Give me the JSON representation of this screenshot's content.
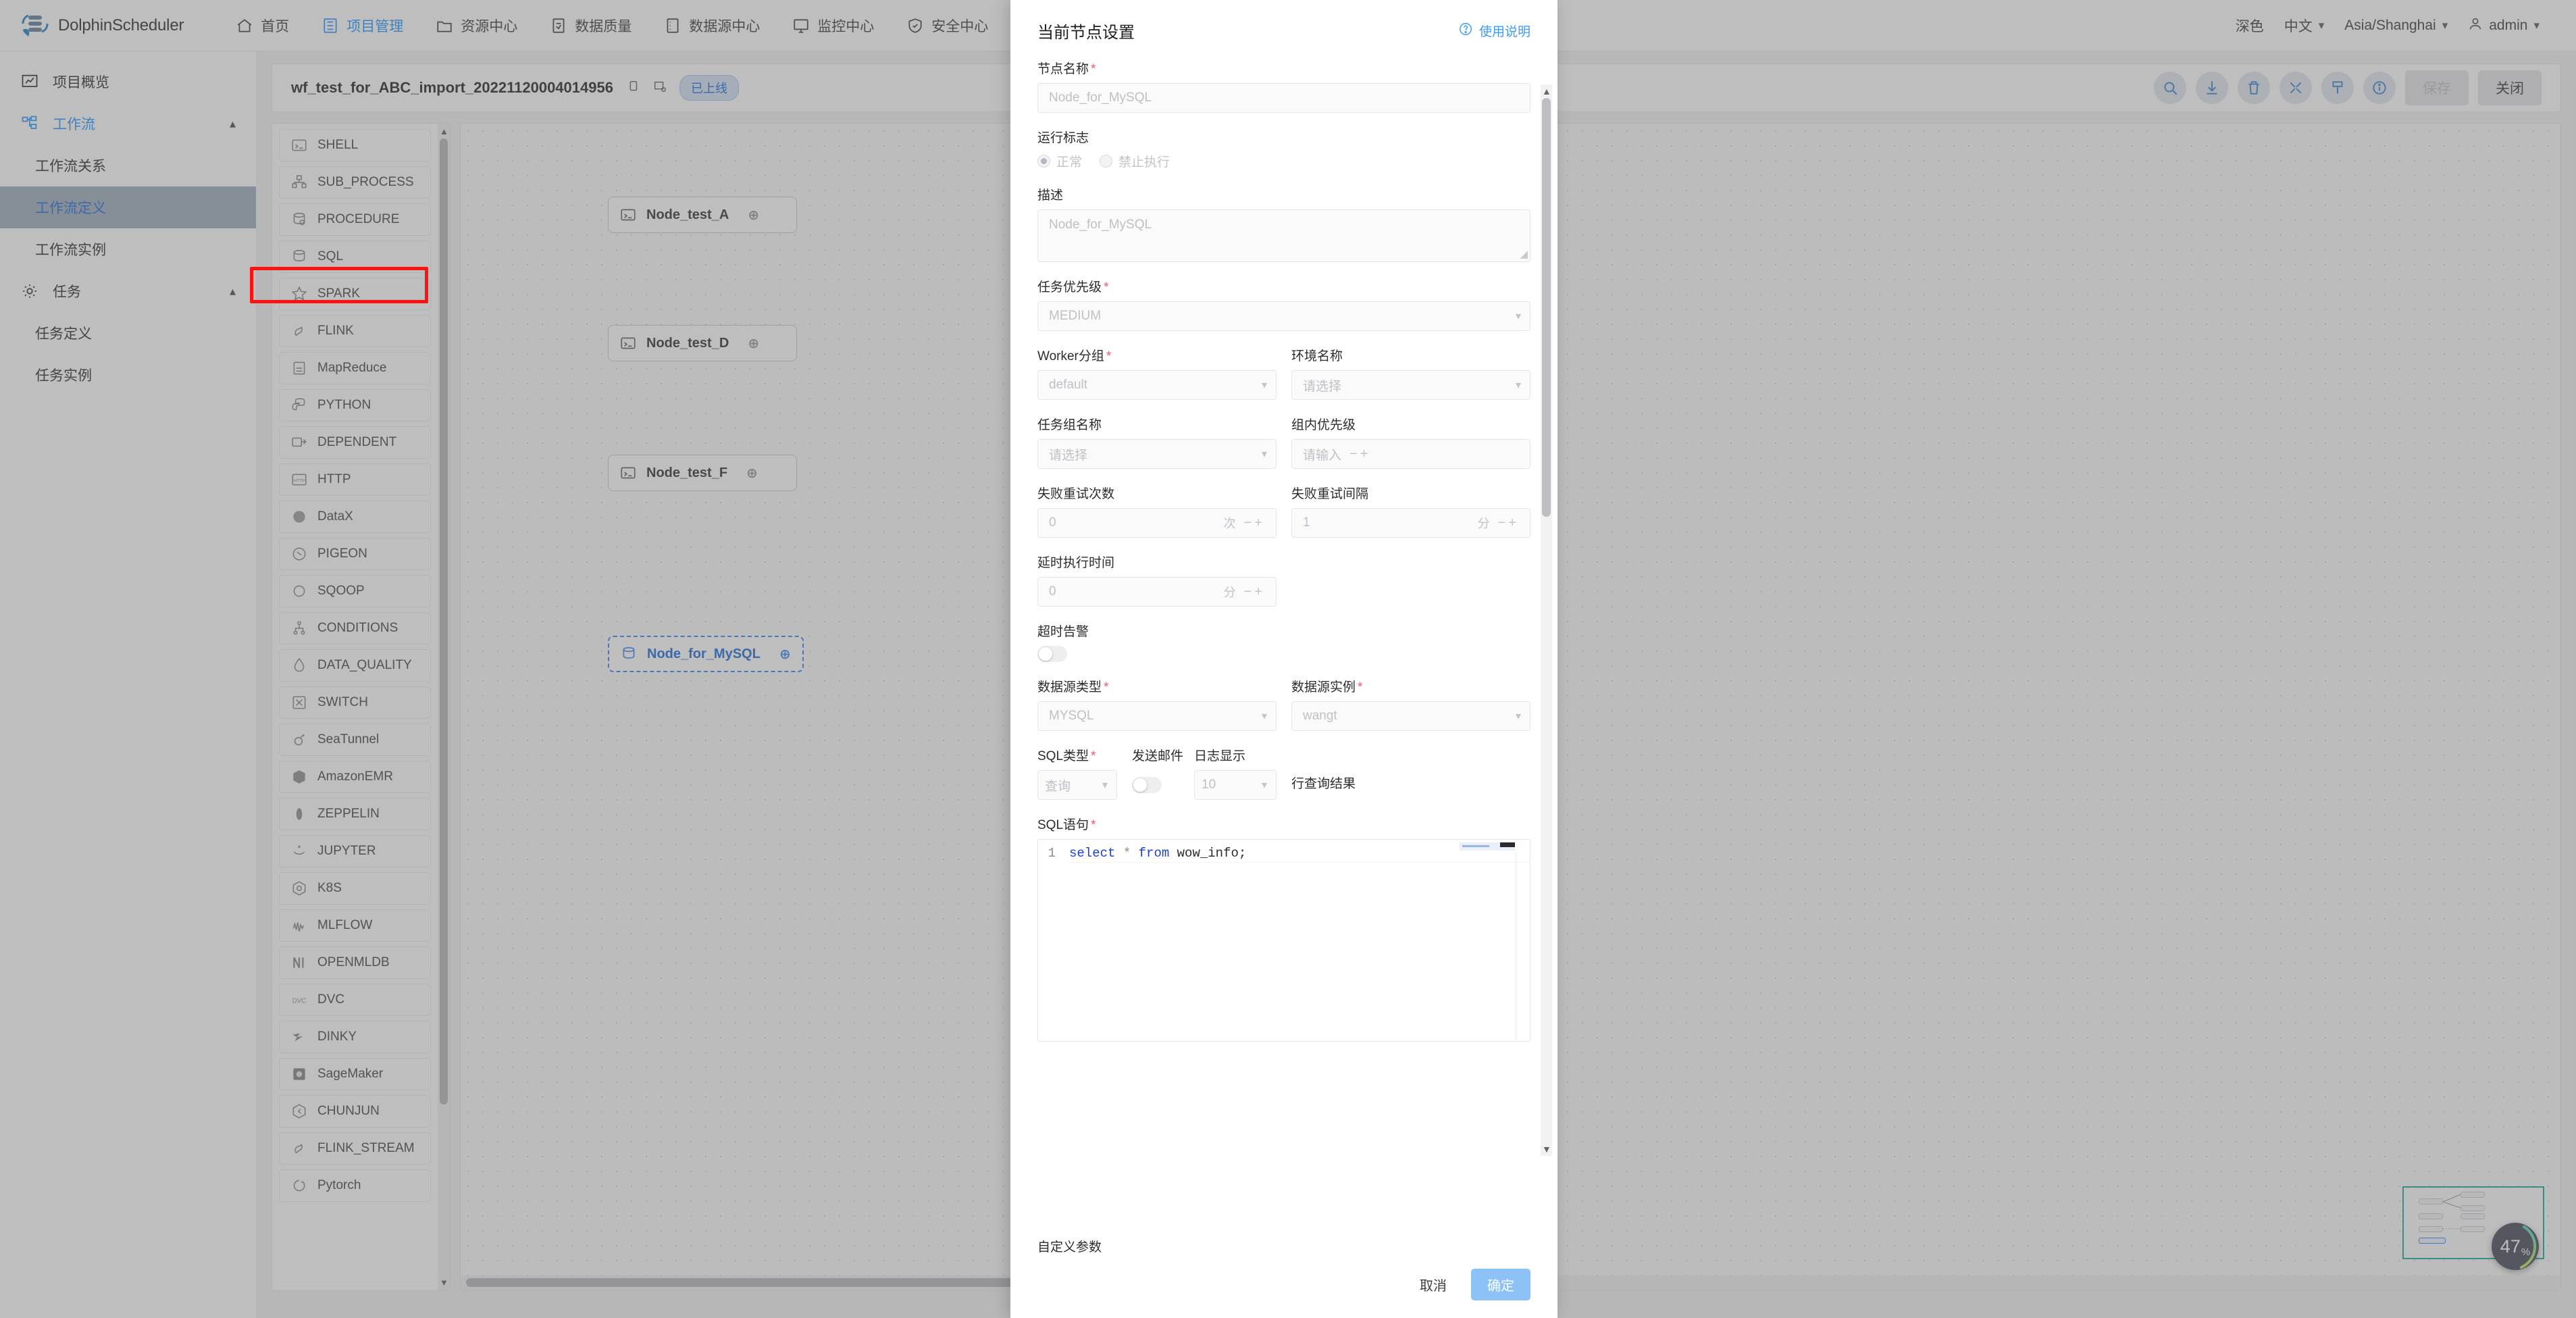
{
  "topnav": {
    "brand": "DolphinScheduler",
    "items": [
      {
        "label": "首页",
        "icon": "home-icon",
        "active": false
      },
      {
        "label": "项目管理",
        "icon": "project-icon",
        "active": true
      },
      {
        "label": "资源中心",
        "icon": "folder-icon",
        "active": false
      },
      {
        "label": "数据质量",
        "icon": "data-quality-icon",
        "active": false
      },
      {
        "label": "数据源中心",
        "icon": "database-icon",
        "active": false
      },
      {
        "label": "监控中心",
        "icon": "monitor-icon",
        "active": false
      },
      {
        "label": "安全中心",
        "icon": "shield-icon",
        "active": false
      }
    ],
    "theme": "深色",
    "language": "中文",
    "timezone": "Asia/Shanghai",
    "user": "admin"
  },
  "sidebar": {
    "overview": "项目概览",
    "workflow_group": "工作流",
    "workflow_items": [
      "工作流关系",
      "工作流定义",
      "工作流实例"
    ],
    "workflow_selected": "工作流定义",
    "task_group": "任务",
    "task_items": [
      "任务定义",
      "任务实例"
    ]
  },
  "workflow": {
    "name": "wf_test_for_ABC_import_20221120004014956",
    "status_badge": "已上线",
    "toolbar": {
      "icons": [
        "search-icon",
        "download-icon",
        "trash-icon",
        "fullscreen-icon",
        "format-icon",
        "info-icon"
      ],
      "save_label": "保存",
      "close_label": "关闭"
    },
    "zoom_level": "47",
    "zoom_unit": "%"
  },
  "task_types": [
    {
      "label": "SHELL",
      "icon": "shell-icon"
    },
    {
      "label": "SUB_PROCESS",
      "icon": "subprocess-icon"
    },
    {
      "label": "PROCEDURE",
      "icon": "procedure-icon"
    },
    {
      "label": "SQL",
      "icon": "sql-icon",
      "highlighted": true
    },
    {
      "label": "SPARK",
      "icon": "spark-icon"
    },
    {
      "label": "FLINK",
      "icon": "flink-icon"
    },
    {
      "label": "MapReduce",
      "icon": "mapreduce-icon"
    },
    {
      "label": "PYTHON",
      "icon": "python-icon"
    },
    {
      "label": "DEPENDENT",
      "icon": "dependent-icon"
    },
    {
      "label": "HTTP",
      "icon": "http-icon"
    },
    {
      "label": "DataX",
      "icon": "datax-icon"
    },
    {
      "label": "PIGEON",
      "icon": "pigeon-icon"
    },
    {
      "label": "SQOOP",
      "icon": "sqoop-icon"
    },
    {
      "label": "CONDITIONS",
      "icon": "conditions-icon"
    },
    {
      "label": "DATA_QUALITY",
      "icon": "data-quality-icon"
    },
    {
      "label": "SWITCH",
      "icon": "switch-icon"
    },
    {
      "label": "SeaTunnel",
      "icon": "seatunnel-icon"
    },
    {
      "label": "AmazonEMR",
      "icon": "emr-icon"
    },
    {
      "label": "ZEPPELIN",
      "icon": "zeppelin-icon"
    },
    {
      "label": "JUPYTER",
      "icon": "jupyter-icon"
    },
    {
      "label": "K8S",
      "icon": "k8s-icon"
    },
    {
      "label": "MLFLOW",
      "icon": "mlflow-icon"
    },
    {
      "label": "OPENMLDB",
      "icon": "openmldb-icon"
    },
    {
      "label": "DVC",
      "icon": "dvc-icon"
    },
    {
      "label": "DINKY",
      "icon": "dinky-icon"
    },
    {
      "label": "SageMaker",
      "icon": "sagemaker-icon"
    },
    {
      "label": "CHUNJUN",
      "icon": "chunjun-icon"
    },
    {
      "label": "FLINK_STREAM",
      "icon": "flink-stream-icon"
    },
    {
      "label": "Pytorch",
      "icon": "pytorch-icon"
    }
  ],
  "canvas_nodes": [
    {
      "label": "Node_test_A",
      "icon": "shell-icon",
      "selected": false
    },
    {
      "label": "Node_test_D",
      "icon": "shell-icon",
      "selected": false
    },
    {
      "label": "Node_test_F",
      "icon": "shell-icon",
      "selected": false
    },
    {
      "label": "Node_for_MySQL",
      "icon": "sql-icon",
      "selected": true
    }
  ],
  "modal": {
    "title": "当前节点设置",
    "help_link": "使用说明",
    "node_name": {
      "label": "节点名称",
      "required": true,
      "placeholder": "Node_for_MySQL"
    },
    "run_flag": {
      "label": "运行标志",
      "options": [
        "正常",
        "禁止执行"
      ],
      "selected": "正常"
    },
    "description": {
      "label": "描述",
      "required": false,
      "placeholder": "Node_for_MySQL"
    },
    "task_priority": {
      "label": "任务优先级",
      "required": true,
      "value": "MEDIUM"
    },
    "worker_group": {
      "label": "Worker分组",
      "required": true,
      "value": "default"
    },
    "environment_name": {
      "label": "环境名称",
      "required": false,
      "placeholder": "请选择"
    },
    "task_group_name": {
      "label": "任务组名称",
      "required": false,
      "placeholder": "请选择"
    },
    "group_priority": {
      "label": "组内优先级",
      "required": false,
      "placeholder": "请输入"
    },
    "retry_times": {
      "label": "失败重试次数",
      "value": "0",
      "unit": "次"
    },
    "retry_interval": {
      "label": "失败重试间隔",
      "value": "1",
      "unit": "分"
    },
    "delay_time": {
      "label": "延时执行时间",
      "value": "0",
      "unit": "分"
    },
    "timeout_alarm": {
      "label": "超时告警",
      "enabled": false
    },
    "datasource_type": {
      "label": "数据源类型",
      "required": true,
      "value": "MYSQL"
    },
    "datasource_instance": {
      "label": "数据源实例",
      "required": true,
      "value": "wangt"
    },
    "sql_type": {
      "label": "SQL类型",
      "required": true,
      "value": "查询"
    },
    "send_email": {
      "label": "发送邮件",
      "enabled": false
    },
    "log_display": {
      "label": "日志显示",
      "value": "10",
      "suffix": "行查询结果"
    },
    "sql_statement": {
      "label": "SQL语句",
      "required": true,
      "lines": [
        {
          "num": "1",
          "kw1": "select",
          "op": "*",
          "kw2": "from",
          "id": "wow_info;"
        }
      ]
    },
    "custom_params_label": "自定义参数",
    "cancel_label": "取消",
    "confirm_label": "确定"
  }
}
